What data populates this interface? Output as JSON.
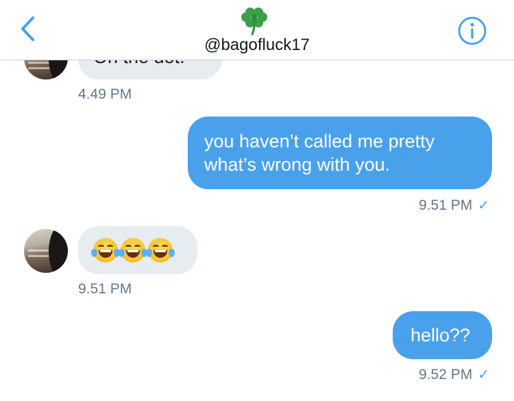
{
  "header": {
    "handle": "@bagofluck17",
    "title_emoji": "four-leaf-clover",
    "back_icon": "chevron-left-icon",
    "info_icon": "info-icon",
    "accent_color": "#4aa1eb"
  },
  "messages": [
    {
      "direction": "incoming",
      "text": "On the dot.",
      "time": "4.49 PM"
    },
    {
      "direction": "outgoing",
      "lines": [
        "you haven’t called me pretty",
        "what’s wrong with you."
      ],
      "time": "9.51 PM",
      "status": "✓"
    },
    {
      "direction": "incoming",
      "emoji": [
        "face-with-tears-of-joy",
        "face-with-tears-of-joy",
        "face-with-tears-of-joy"
      ],
      "time": "9.51 PM"
    },
    {
      "direction": "outgoing",
      "text": "hello??",
      "time": "9.52 PM",
      "status": "✓"
    }
  ]
}
